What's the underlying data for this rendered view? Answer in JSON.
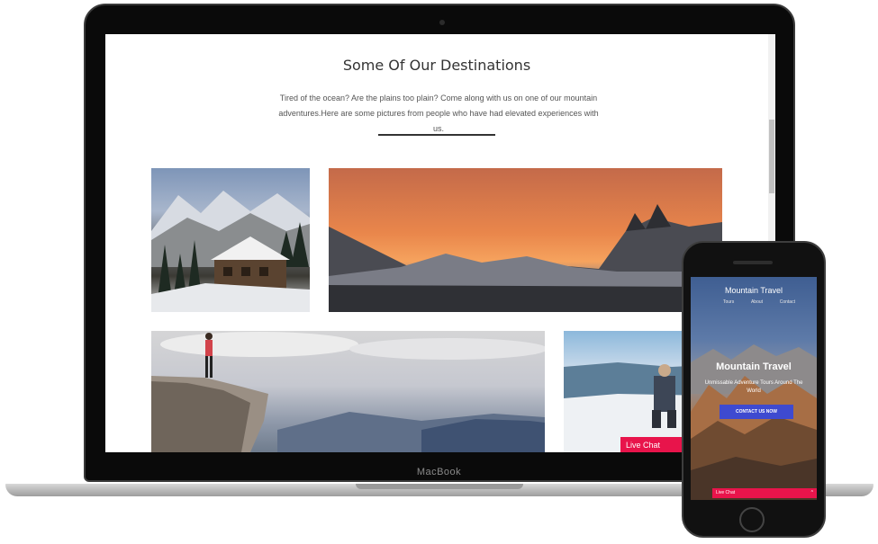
{
  "laptop": {
    "brand": "MacBook",
    "page": {
      "title": "Some Of Our Destinations",
      "intro_line1": "Tired of the ocean? Are the plains too plain? Come along with us on one of our mountain",
      "intro_line2": "adventures.Here are some pictures from people who have had elevated experiences with us.",
      "photos": [
        "snowy-chalet-photo",
        "sunset-mountains-photo",
        "hiker-on-cliff-photo",
        "snow-hiker-photo"
      ],
      "live_chat_label": "Live Chat"
    }
  },
  "phone": {
    "site_name": "Mountain Travel",
    "nav": [
      "Tours",
      "About",
      "Contact"
    ],
    "hero_title": "Mountain Travel",
    "hero_subtitle": "Unmissable Adventure Tours Around The World",
    "cta_label": "CONTACT US NOW",
    "live_chat_label": "Live Chat",
    "live_chat_caret": "^"
  },
  "colors": {
    "live_chat": "#e8144b",
    "cta": "#3e4ad0",
    "divider": "#333333"
  }
}
